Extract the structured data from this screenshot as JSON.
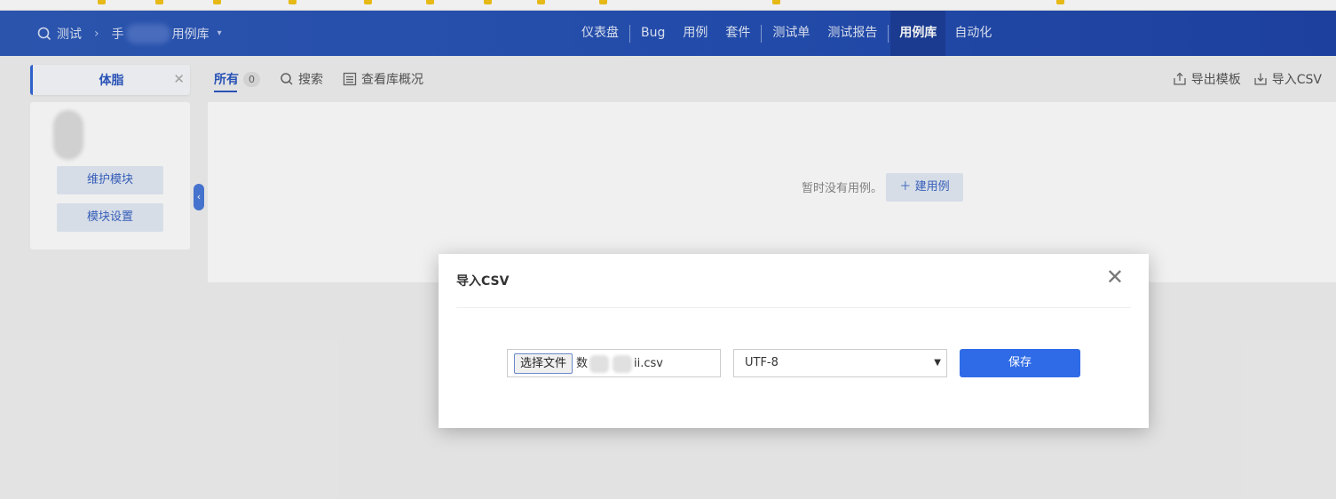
{
  "header": {
    "product": "测试",
    "breadcrumb_product": "手",
    "breadcrumb_lib": "用例库",
    "nav": [
      "仪表盘",
      "Bug",
      "用例",
      "套件",
      "测试单",
      "测试报告",
      "用例库",
      "自动化"
    ],
    "active_nav": "用例库"
  },
  "subnav": {
    "module_tab": "体脂",
    "tab_all": "所有",
    "tab_all_count": "0",
    "search": "搜索",
    "view_lib": "查看库概况",
    "export_template": "导出模板",
    "import_csv": "导入CSV"
  },
  "sidebar": {
    "maintain_module": "维护模块",
    "module_settings": "模块设置"
  },
  "content": {
    "empty_message": "暂时没有用例。",
    "new_case": "建用例"
  },
  "modal": {
    "title": "导入CSV",
    "choose_file": "选择文件",
    "file_name_prefix": "数",
    "file_name_suffix": "ii.csv",
    "encoding": "UTF-8",
    "save": "保存"
  },
  "colors": {
    "header_bg": "#2651b5",
    "accent": "#2f6be6",
    "soft_button_bg": "#e4ebf6"
  }
}
